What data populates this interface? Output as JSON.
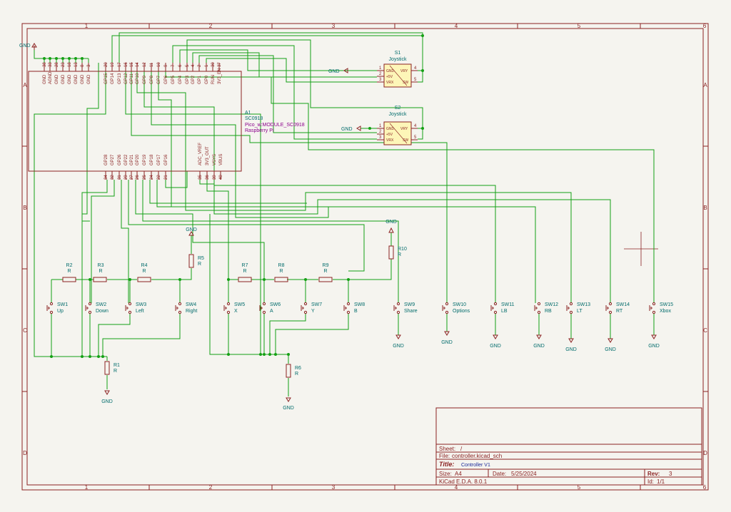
{
  "frame": {
    "columns": [
      "1",
      "2",
      "3",
      "4",
      "5",
      "6"
    ],
    "rows": [
      "A",
      "B",
      "C",
      "D"
    ]
  },
  "module": {
    "ref": "A1",
    "part": "SC0918",
    "footprint": "Pico_w:MODULE_SC0918",
    "vendor": "Raspberry Pi",
    "top_pins": [
      {
        "num": "38",
        "name": "GND"
      },
      {
        "num": "33",
        "name": "AGND"
      },
      {
        "num": "28",
        "name": "GND"
      },
      {
        "num": "23",
        "name": "GND"
      },
      {
        "num": "18",
        "name": "GND"
      },
      {
        "num": "13",
        "name": "GND"
      },
      {
        "num": "8",
        "name": "GND"
      },
      {
        "num": "3",
        "name": "GND"
      },
      {
        "num": "20",
        "name": "GP15"
      },
      {
        "num": "19",
        "name": "GP14"
      },
      {
        "num": "17",
        "name": "GP13"
      },
      {
        "num": "16",
        "name": "GP12"
      },
      {
        "num": "15",
        "name": "GP11"
      },
      {
        "num": "14",
        "name": "GP10"
      },
      {
        "num": "12",
        "name": "GP9"
      },
      {
        "num": "11",
        "name": "GP8"
      },
      {
        "num": "10",
        "name": "GP7"
      },
      {
        "num": "9",
        "name": "GP6"
      },
      {
        "num": "7",
        "name": "GP5"
      },
      {
        "num": "6",
        "name": "GP4"
      },
      {
        "num": "5",
        "name": "GP3"
      },
      {
        "num": "4",
        "name": "GP2"
      },
      {
        "num": "2",
        "name": "GP1"
      },
      {
        "num": "1",
        "name": "GP0"
      },
      {
        "num": "30",
        "name": "RUN"
      },
      {
        "num": "37",
        "name": "3V3_EN"
      }
    ],
    "bottom_pins": [
      {
        "num": "34",
        "name": "GP28"
      },
      {
        "num": "32",
        "name": "GP27"
      },
      {
        "num": "31",
        "name": "GP26"
      },
      {
        "num": "29",
        "name": "GP22"
      },
      {
        "num": "27",
        "name": "GP21"
      },
      {
        "num": "26",
        "name": "GP20"
      },
      {
        "num": "25",
        "name": "GP19"
      },
      {
        "num": "24",
        "name": "GP18"
      },
      {
        "num": "22",
        "name": "GP17"
      },
      {
        "num": "21",
        "name": "GP16"
      },
      {
        "num": "35",
        "name": "ADC_VREF"
      },
      {
        "num": "36",
        "name": "3V3_OUT"
      },
      {
        "num": "39",
        "name": "VSYS"
      },
      {
        "num": "40",
        "name": "VBUS"
      }
    ]
  },
  "joysticks": [
    {
      "ref": "S1",
      "value": "Joystick",
      "inner": [
        "GND",
        "+5V",
        "VRX",
        "VRY",
        "SW"
      ],
      "pins": [
        "1",
        "2",
        "3",
        "4",
        "5"
      ]
    },
    {
      "ref": "S2",
      "value": "Joystick",
      "inner": [
        "GND",
        "+5V",
        "VRX",
        "VRY",
        "SW"
      ],
      "pins": [
        "1",
        "2",
        "3",
        "4",
        "5"
      ]
    }
  ],
  "resistors": [
    {
      "ref": "R1",
      "value": "R"
    },
    {
      "ref": "R2",
      "value": "R"
    },
    {
      "ref": "R3",
      "value": "R"
    },
    {
      "ref": "R4",
      "value": "R"
    },
    {
      "ref": "R5",
      "value": "R"
    },
    {
      "ref": "R6",
      "value": "R"
    },
    {
      "ref": "R7",
      "value": "R"
    },
    {
      "ref": "R8",
      "value": "R"
    },
    {
      "ref": "R9",
      "value": "R"
    },
    {
      "ref": "R10",
      "value": "R"
    }
  ],
  "switches": [
    {
      "ref": "SW1",
      "label": "Up"
    },
    {
      "ref": "SW2",
      "label": "Down"
    },
    {
      "ref": "SW3",
      "label": "Left"
    },
    {
      "ref": "SW4",
      "label": "Right"
    },
    {
      "ref": "SW5",
      "label": "X"
    },
    {
      "ref": "SW6",
      "label": "A"
    },
    {
      "ref": "SW7",
      "label": "Y"
    },
    {
      "ref": "SW8",
      "label": "B"
    },
    {
      "ref": "SW9",
      "label": "Share"
    },
    {
      "ref": "SW10",
      "label": "Options"
    },
    {
      "ref": "SW11",
      "label": "LB"
    },
    {
      "ref": "SW12",
      "label": "RB"
    },
    {
      "ref": "SW13",
      "label": "LT"
    },
    {
      "ref": "SW14",
      "label": "RT"
    },
    {
      "ref": "SW15",
      "label": "Xbox"
    }
  ],
  "gnd_label": "GND",
  "title_block": {
    "sheet_label": "Sheet:",
    "sheet": "/",
    "file_label": "File:",
    "file": "controller.kicad_sch",
    "title_label": "Title:",
    "title": "Controller V1",
    "size_label": "Size:",
    "size": "A4",
    "date_label": "Date:",
    "date": "5/25/2024",
    "rev_label": "Rev:",
    "rev": "3",
    "tool": "KiCad E.D.A. 8.0.1",
    "id_label": "Id:",
    "id": "1/1"
  },
  "colors": {
    "wire": "#14a014",
    "border": "#8b2222",
    "label": "#006b6b",
    "symbol_fill": "#fdf6b8",
    "background": "#f5f4ef"
  }
}
